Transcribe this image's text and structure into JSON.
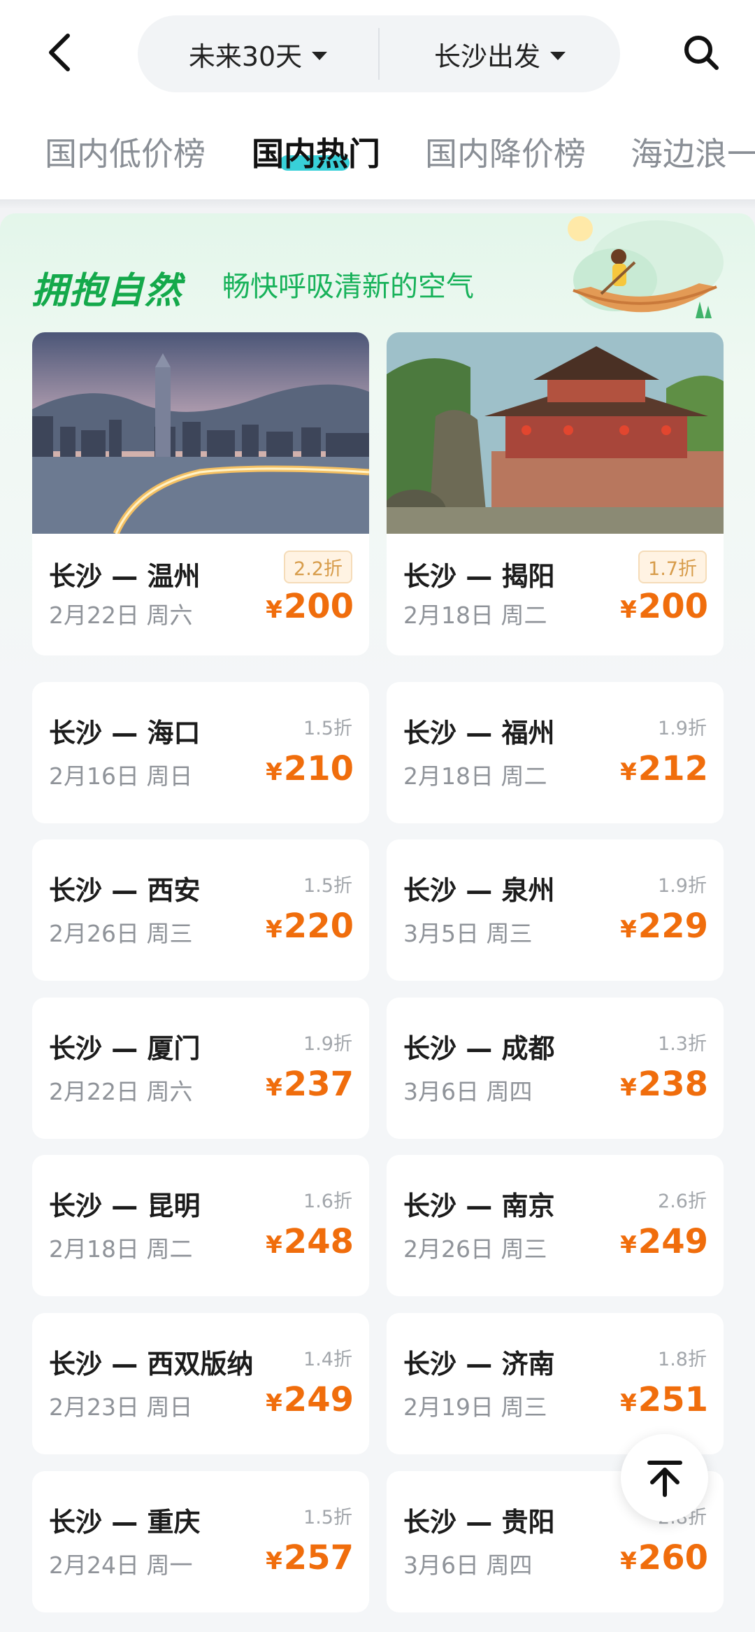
{
  "header": {
    "date_filter": "未来30天",
    "departure_filter": "长沙出发"
  },
  "tabs": [
    {
      "label": "国内低价榜"
    },
    {
      "label": "国内热门"
    },
    {
      "label": "国内降价榜"
    },
    {
      "label": "海边浪一"
    }
  ],
  "active_tab_index": 1,
  "banner": {
    "title": "拥抱自然",
    "subtitle": "畅快呼吸清新的空气"
  },
  "colors": {
    "accent_green": "#14a94b",
    "price_orange": "#f06d0c",
    "tab_underline": "#38d0d8"
  },
  "currency_symbol": "¥",
  "featured": [
    {
      "route": "长沙 — 温州",
      "date": "2月22日 周六",
      "discount": "2.2折",
      "price": "200",
      "image": "city-night-bridge"
    },
    {
      "route": "长沙 — 揭阳",
      "date": "2月18日 周二",
      "discount": "1.7折",
      "price": "200",
      "image": "chinese-pavilion"
    }
  ],
  "flights": [
    {
      "route": "长沙 — 海口",
      "date": "2月16日 周日",
      "discount": "1.5折",
      "price": "210"
    },
    {
      "route": "长沙 — 福州",
      "date": "2月18日 周二",
      "discount": "1.9折",
      "price": "212"
    },
    {
      "route": "长沙 — 西安",
      "date": "2月26日 周三",
      "discount": "1.5折",
      "price": "220"
    },
    {
      "route": "长沙 — 泉州",
      "date": "3月5日 周三",
      "discount": "1.9折",
      "price": "229"
    },
    {
      "route": "长沙 — 厦门",
      "date": "2月22日 周六",
      "discount": "1.9折",
      "price": "237"
    },
    {
      "route": "长沙 — 成都",
      "date": "3月6日 周四",
      "discount": "1.3折",
      "price": "238"
    },
    {
      "route": "长沙 — 昆明",
      "date": "2月18日 周二",
      "discount": "1.6折",
      "price": "248"
    },
    {
      "route": "长沙 — 南京",
      "date": "2月26日 周三",
      "discount": "2.6折",
      "price": "249"
    },
    {
      "route": "长沙 — 西双版纳",
      "date": "2月23日 周日",
      "discount": "1.4折",
      "price": "249"
    },
    {
      "route": "长沙 — 济南",
      "date": "2月19日 周三",
      "discount": "1.8折",
      "price": "251"
    },
    {
      "route": "长沙 — 重庆",
      "date": "2月24日 周一",
      "discount": "1.5折",
      "price": "257"
    },
    {
      "route": "长沙 — 贵阳",
      "date": "3月6日 周四",
      "discount": "2.8折",
      "price": "260"
    }
  ]
}
